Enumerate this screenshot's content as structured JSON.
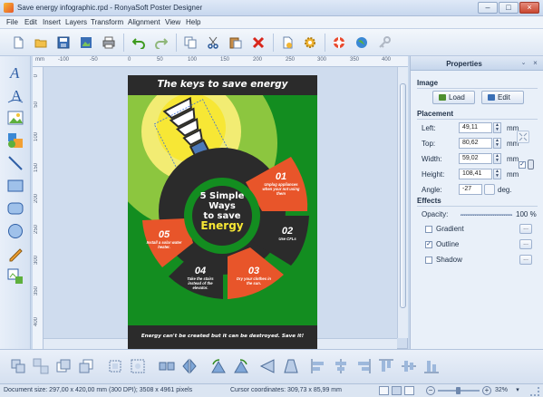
{
  "window": {
    "title": "Save energy infographic.rpd - RonyaSoft Poster Designer",
    "controls": [
      "–",
      "□",
      "×"
    ]
  },
  "menu": [
    "File",
    "Edit",
    "Insert",
    "Layers",
    "Transform",
    "Alignment",
    "View",
    "Help"
  ],
  "toolbar": [
    "new-document-icon",
    "open-folder-icon",
    "save-icon",
    "save-image-icon",
    "print-icon",
    "undo-icon",
    "redo-icon",
    "copy-icon",
    "cut-icon",
    "paste-icon",
    "delete-icon",
    "page-settings-icon",
    "preferences-gear-icon",
    "help-lifebuoy-icon",
    "web-globe-icon",
    "key-icon"
  ],
  "left_tools": [
    "text-tool-icon",
    "curved-text-tool-icon",
    "image-tool-icon",
    "clipart-tool-icon",
    "line-tool-icon",
    "rectangle-tool-icon",
    "rounded-rectangle-tool-icon",
    "ellipse-tool-icon",
    "pencil-tool-icon",
    "layout-tool-icon"
  ],
  "ruler": {
    "unit": "mm",
    "top_ticks": [
      "-100",
      "-50",
      "0",
      "50",
      "100",
      "150",
      "200",
      "250",
      "300",
      "350",
      "400"
    ],
    "left_ticks": [
      "0",
      "50",
      "100",
      "150",
      "200",
      "250",
      "300",
      "350",
      "400",
      "450"
    ]
  },
  "poster": {
    "headline": "The keys to save energy",
    "center_line1": "5 Simple",
    "center_line2": "Ways",
    "center_line3": "to save",
    "center_line4": "Energy",
    "tips": [
      {
        "num": "01",
        "text": "Unplug appliances when your not using them"
      },
      {
        "num": "02",
        "text": "Use CFLs"
      },
      {
        "num": "03",
        "text": "Dry your clothes in the sun."
      },
      {
        "num": "04",
        "text": "Take the stairs instead of the elevator."
      },
      {
        "num": "05",
        "text": "Install a solar water heater."
      }
    ],
    "footer": "Energy can't be created but it can be destroyed. Save it!",
    "colors": {
      "green": "#138d20",
      "orange": "#e8552a",
      "dark": "#2b2b2b",
      "yellow": "#f7e735",
      "lime": "#8cc63f"
    }
  },
  "properties": {
    "title": "Properties",
    "image_section": "Image",
    "load_label": "Load",
    "edit_label": "Edit",
    "placement_section": "Placement",
    "left": {
      "label": "Left:",
      "value": "49,11",
      "unit": "mm"
    },
    "top": {
      "label": "Top:",
      "value": "80,62",
      "unit": "mm"
    },
    "width": {
      "label": "Width:",
      "value": "59,02",
      "unit": "mm"
    },
    "height": {
      "label": "Height:",
      "value": "108,41",
      "unit": "mm"
    },
    "angle": {
      "label": "Angle:",
      "value": "-27",
      "unit": "deg."
    },
    "effects_section": "Effects",
    "opacity_label": "Opacity:",
    "opacity_value": "100 %",
    "gradient_label": "Gradient",
    "outline_label": "Outline",
    "shadow_label": "Shadow"
  },
  "bottom_tools": [
    "group-icon",
    "ungroup-icon",
    "bring-forward-icon",
    "send-backward-icon",
    "align-grid-icon",
    "fit-page-icon",
    "distribute-icon",
    "flip-horizontal-icon",
    "flip-vertical-icon",
    "rotate-left-icon",
    "rotate-right-icon",
    "skew-left-icon",
    "skew-right-icon",
    "align-left-icon",
    "align-center-icon",
    "align-right-icon",
    "align-top-icon",
    "align-middle-icon",
    "align-bottom-icon",
    "same-width-icon",
    "same-height-icon"
  ],
  "status": {
    "doc_size": "Document size: 297,00 x 420,00 mm (300 DPI); 3508 x 4961 pixels",
    "cursor": "Cursor coordinates: 309,73 x 85,99 mm",
    "zoom": "32%"
  }
}
